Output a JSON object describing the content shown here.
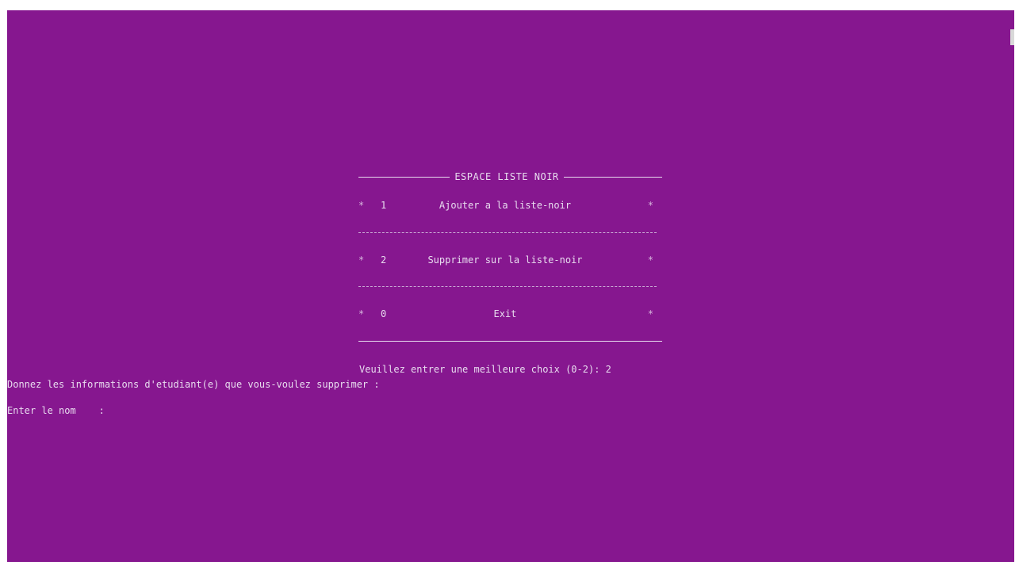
{
  "menu": {
    "title": "ESPACE LISTE NOIR",
    "star": "*",
    "items": [
      {
        "number": "1",
        "label": "Ajouter a la liste-noir"
      },
      {
        "number": "2",
        "label": "Supprimer sur la liste-noir"
      },
      {
        "number": "0",
        "label": "Exit"
      }
    ]
  },
  "console": {
    "choice_prompt": "Veuillez entrer une meilleure choix (0-2): 2",
    "info_prompt": "Donnez les informations d'etudiant(e) que vous-voulez supprimer :",
    "name_prompt": "Enter le nom    :"
  },
  "colors": {
    "background": "#86178f",
    "text": "#e8dcef"
  }
}
